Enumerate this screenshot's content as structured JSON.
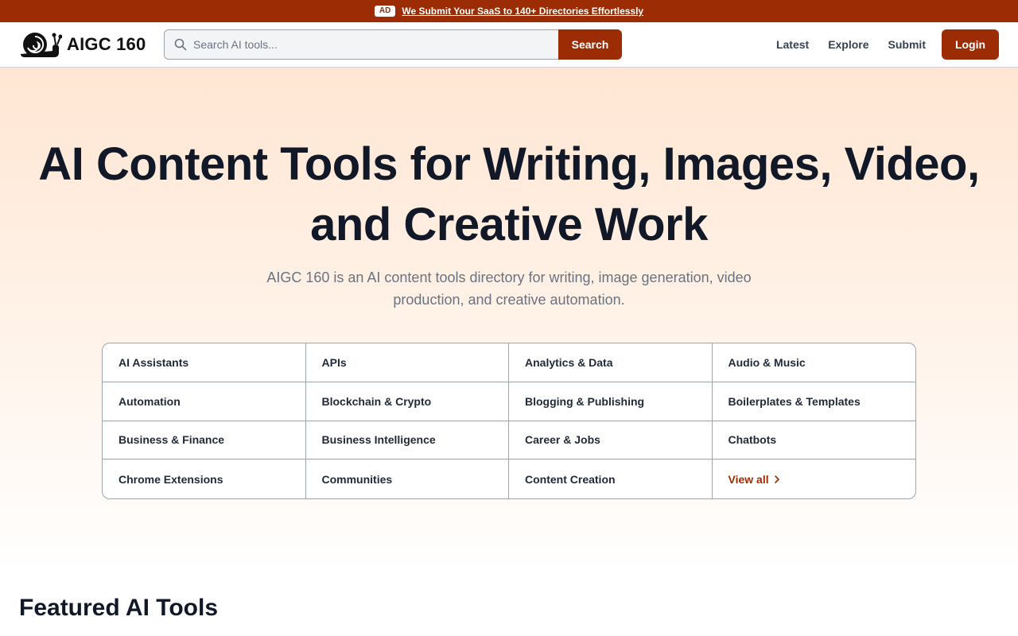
{
  "ad": {
    "badge": "AD",
    "text": "We Submit Your SaaS to 140+ Directories Effortlessly"
  },
  "header": {
    "logo_text": "AIGC 160",
    "search_placeholder": "Search AI tools...",
    "search_button": "Search",
    "nav": [
      "Latest",
      "Explore",
      "Submit"
    ],
    "login": "Login"
  },
  "hero": {
    "title_line1": "AI Content Tools for Writing, Images, Video,",
    "title_line2": "and Creative Work",
    "subtitle": "AIGC 160 is an AI content tools directory for writing, image generation, video production, and creative automation."
  },
  "categories": [
    "AI Assistants",
    "APIs",
    "Analytics & Data",
    "Audio & Music",
    "Automation",
    "Blockchain & Crypto",
    "Blogging & Publishing",
    "Boilerplates & Templates",
    "Business & Finance",
    "Business Intelligence",
    "Career & Jobs",
    "Chatbots",
    "Chrome Extensions",
    "Communities",
    "Content Creation"
  ],
  "view_all": "View all",
  "featured": {
    "title": "Featured AI Tools"
  },
  "colors": {
    "brand": "#9b2c04",
    "text": "#111827",
    "muted": "#6b7280"
  }
}
